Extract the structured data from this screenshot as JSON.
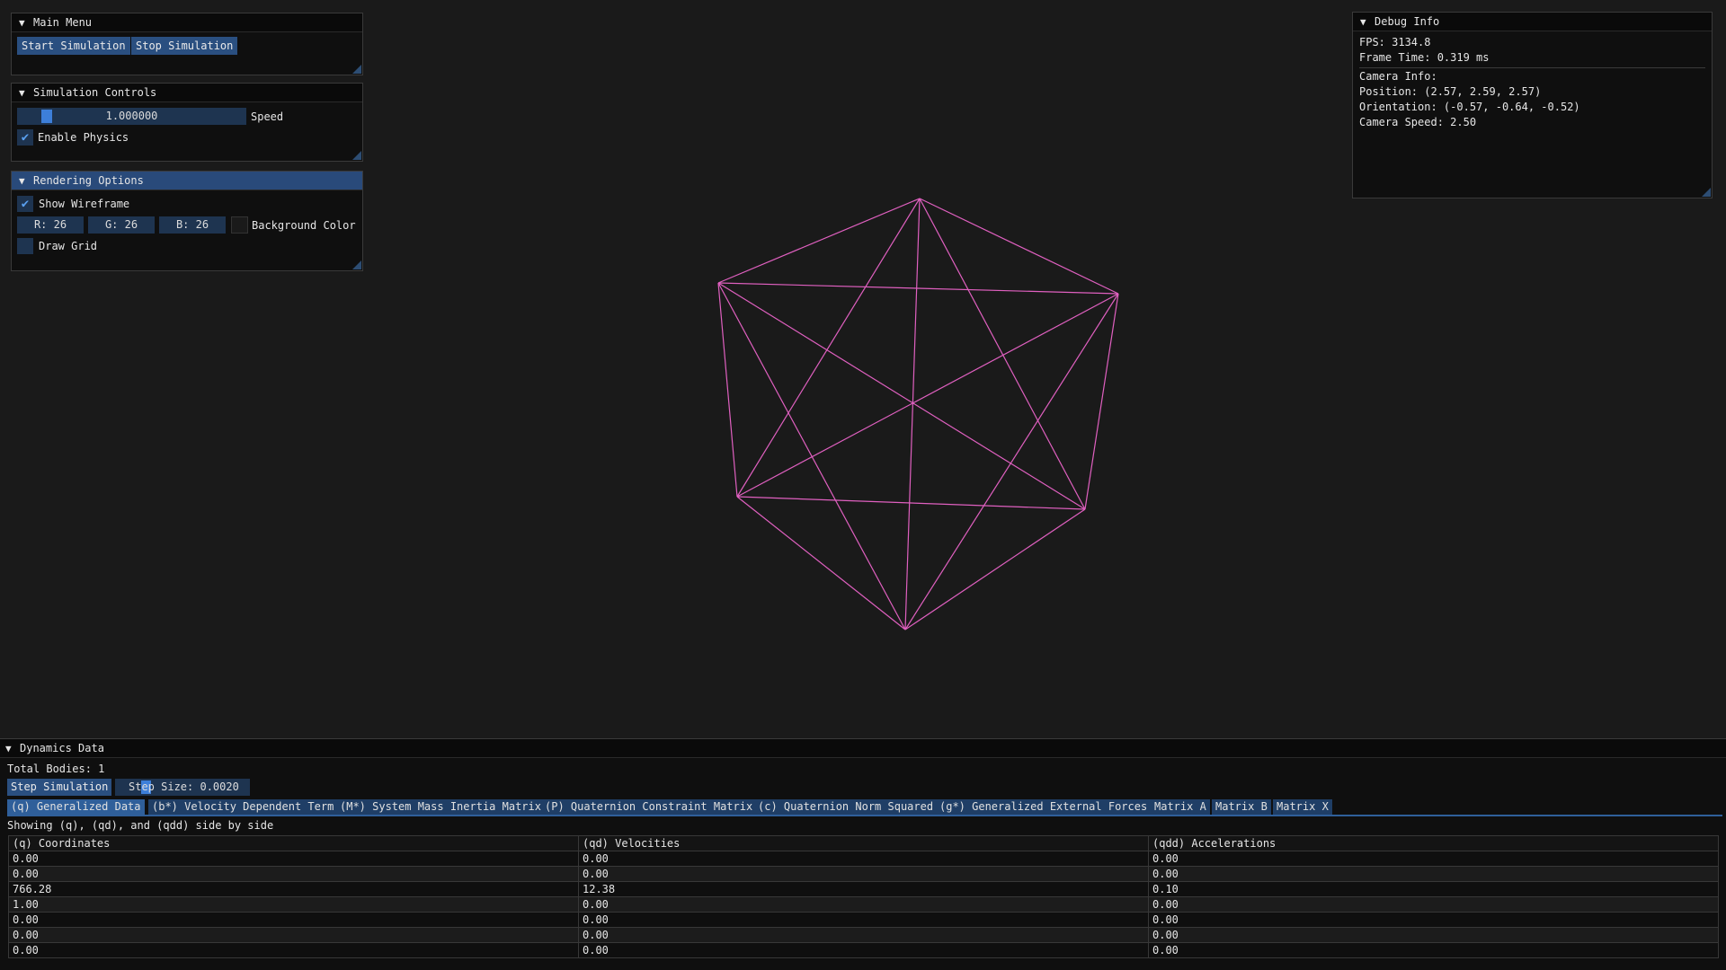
{
  "main_menu": {
    "title": "Main Menu",
    "start_label": "Start Simulation",
    "stop_label": "Stop Simulation"
  },
  "sim_controls": {
    "title": "Simulation Controls",
    "speed_value": "1.000000",
    "speed_label": "Speed",
    "enable_physics_label": "Enable Physics",
    "enable_physics_checked": true
  },
  "rendering": {
    "title": "Rendering Options",
    "show_wireframe_label": "Show Wireframe",
    "show_wireframe_checked": true,
    "r": "R: 26",
    "g": "G: 26",
    "b": "B: 26",
    "bg_color_label": "Background Color",
    "draw_grid_label": "Draw Grid",
    "draw_grid_checked": false
  },
  "debug": {
    "title": "Debug Info",
    "fps": "FPS: 3134.8",
    "frame_time": "Frame Time: 0.319 ms",
    "camera_info": "Camera Info:",
    "position": "Position: (2.57, 2.59, 2.57)",
    "orientation": "Orientation: (-0.57, -0.64, -0.52)",
    "camera_speed": "Camera Speed: 2.50"
  },
  "dynamics": {
    "title": "Dynamics Data",
    "total_bodies": "Total Bodies: 1",
    "step_button": "Step Simulation",
    "step_size": "Step Size: 0.0020",
    "tabs": [
      "(q) Generalized Data",
      "(b*) Velocity Dependent Term",
      "(M*) System Mass Inertia Matrix",
      "(P) Quaternion Constraint Matrix",
      "(c) Quaternion Norm Squared",
      "(g*) Generalized External Forces",
      "Matrix A",
      "Matrix B",
      "Matrix X"
    ],
    "active_tab": 0,
    "showing_text": "Showing (q), (qd), and (qdd) side by side",
    "columns": [
      "(q) Coordinates",
      "(qd) Velocities",
      "(qdd) Accelerations"
    ],
    "rows": [
      [
        "0.00",
        "0.00",
        "0.00"
      ],
      [
        "0.00",
        "0.00",
        "0.00"
      ],
      [
        "766.28",
        "12.38",
        "0.10"
      ],
      [
        "1.00",
        "0.00",
        "0.00"
      ],
      [
        "0.00",
        "0.00",
        "0.00"
      ],
      [
        "0.00",
        "0.00",
        "0.00"
      ],
      [
        "0.00",
        "0.00",
        "0.00"
      ]
    ]
  },
  "wireframe_color": "#e060c0"
}
